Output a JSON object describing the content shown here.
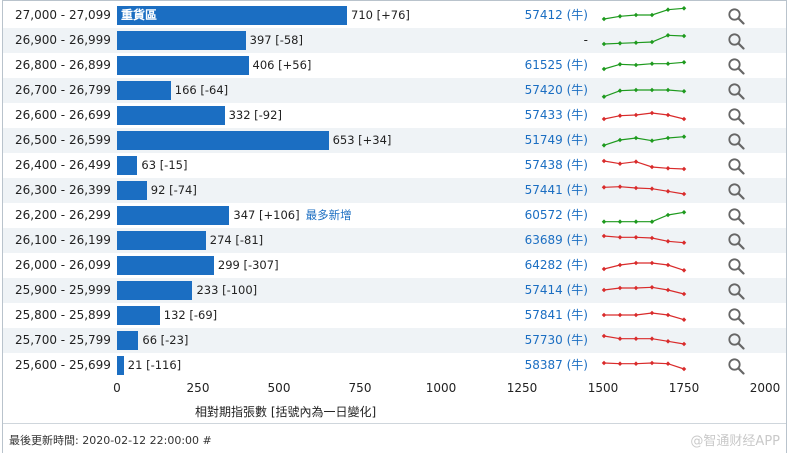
{
  "chart_data": {
    "type": "bar",
    "xlabel": "相對期指張數 [括號內為一日變化]",
    "xlim": [
      0,
      2000
    ],
    "xticks": [
      "0",
      "250",
      "500",
      "750",
      "1000",
      "1250",
      "1500",
      "1750",
      "2000"
    ],
    "rows": [
      {
        "range": "27,000 - 27,099",
        "value": 710,
        "label": "710 [+76]",
        "inner_label": "重貨區",
        "note": "",
        "code": "57412 (牛)",
        "trend": "up",
        "spark": [
          2,
          2.4,
          2.6,
          2.6,
          3.4,
          3.6
        ]
      },
      {
        "range": "26,900 - 26,999",
        "value": 397,
        "label": "397 [-58]",
        "inner_label": "",
        "note": "",
        "code": "-",
        "trend": "up",
        "spark": [
          2,
          2.1,
          2.2,
          2.3,
          3.3,
          3.2
        ]
      },
      {
        "range": "26,800 - 26,899",
        "value": 406,
        "label": "406 [+56]",
        "inner_label": "",
        "note": "",
        "code": "61525 (牛)",
        "trend": "up",
        "spark": [
          2,
          2.7,
          2.6,
          2.8,
          2.8,
          3.0
        ]
      },
      {
        "range": "26,700 - 26,799",
        "value": 166,
        "label": "166 [-64]",
        "inner_label": "",
        "note": "",
        "code": "57420 (牛)",
        "trend": "up",
        "spark": [
          1.6,
          2.5,
          2.6,
          2.6,
          2.6,
          2.4
        ]
      },
      {
        "range": "26,600 - 26,699",
        "value": 332,
        "label": "332 [-92]",
        "inner_label": "",
        "note": "",
        "code": "57433 (牛)",
        "trend": "down",
        "spark": [
          2.0,
          2.5,
          2.6,
          2.9,
          2.6,
          2.0
        ]
      },
      {
        "range": "26,500 - 26,599",
        "value": 653,
        "label": "653 [+34]",
        "inner_label": "",
        "note": "",
        "code": "51749 (牛)",
        "trend": "up",
        "spark": [
          1.8,
          2.6,
          2.9,
          2.5,
          2.9,
          3.1
        ]
      },
      {
        "range": "26,400 - 26,499",
        "value": 63,
        "label": "63 [-15]",
        "inner_label": "",
        "note": "",
        "code": "57438 (牛)",
        "trend": "down",
        "spark": [
          3.2,
          2.8,
          3.1,
          2.3,
          2.1,
          2.0
        ]
      },
      {
        "range": "26,300 - 26,399",
        "value": 92,
        "label": "92 [-74]",
        "inner_label": "",
        "note": "",
        "code": "57441 (牛)",
        "trend": "down",
        "spark": [
          3.0,
          3.1,
          2.9,
          2.8,
          2.4,
          2.0
        ]
      },
      {
        "range": "26,200 - 26,299",
        "value": 347,
        "label": "347 [+106]",
        "inner_label": "",
        "note": "最多新增",
        "code": "60572 (牛)",
        "trend": "up",
        "spark": [
          1.6,
          1.6,
          1.6,
          1.6,
          2.6,
          3.0
        ]
      },
      {
        "range": "26,100 - 26,199",
        "value": 274,
        "label": "274 [-81]",
        "inner_label": "",
        "note": "",
        "code": "63689 (牛)",
        "trend": "down",
        "spark": [
          3.2,
          3.0,
          3.0,
          2.9,
          2.4,
          2.2
        ]
      },
      {
        "range": "26,000 - 26,099",
        "value": 299,
        "label": "299 [-307]",
        "inner_label": "",
        "note": "",
        "code": "64282 (牛)",
        "trend": "down",
        "spark": [
          2.0,
          2.6,
          2.9,
          2.9,
          2.6,
          1.8
        ]
      },
      {
        "range": "25,900 - 25,999",
        "value": 233,
        "label": "233 [-100]",
        "inner_label": "",
        "note": "",
        "code": "57414 (牛)",
        "trend": "down",
        "spark": [
          2.6,
          2.9,
          2.9,
          3.0,
          2.6,
          2.0
        ]
      },
      {
        "range": "25,800 - 25,899",
        "value": 132,
        "label": "132 [-69]",
        "inner_label": "",
        "note": "",
        "code": "57841 (牛)",
        "trend": "down",
        "spark": [
          2.6,
          2.6,
          2.6,
          2.9,
          2.6,
          1.9
        ]
      },
      {
        "range": "25,700 - 25,799",
        "value": 66,
        "label": "66 [-23]",
        "inner_label": "",
        "note": "",
        "code": "57730 (牛)",
        "trend": "down",
        "spark": [
          3.2,
          2.8,
          2.8,
          2.8,
          2.4,
          2.0
        ]
      },
      {
        "range": "25,600 - 25,699",
        "value": 21,
        "label": "21 [-116]",
        "inner_label": "",
        "note": "",
        "code": "58387 (牛)",
        "trend": "down",
        "spark": [
          2.9,
          2.8,
          2.8,
          2.9,
          2.8,
          2.0
        ]
      }
    ]
  },
  "colors": {
    "bar": "#1b6ec2",
    "spark_up": "#1e9a1e",
    "spark_down": "#d92b2b",
    "link": "#1b6ec2",
    "row_alt": "#eff3f6"
  },
  "icons": {
    "row_action": "search-icon"
  },
  "footer": {
    "updated": "最後更新時間: 2020-02-12 22:00:00 #",
    "watermark": "@智通财经APP"
  }
}
